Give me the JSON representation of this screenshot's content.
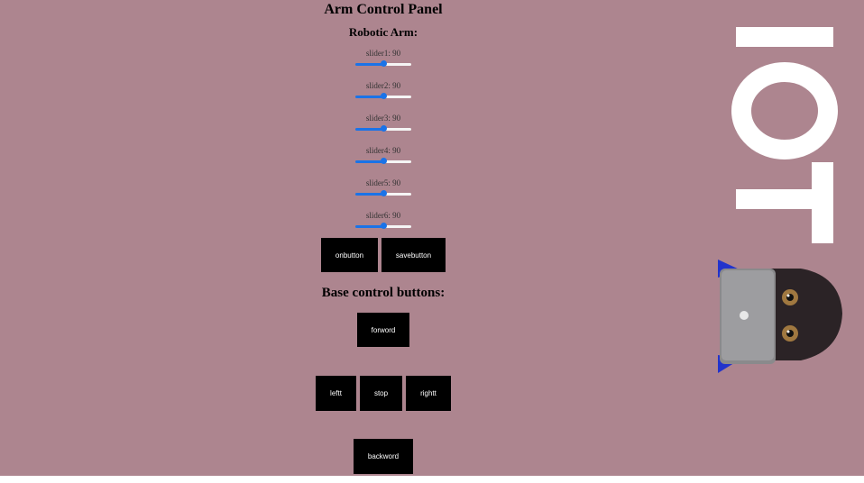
{
  "panel": {
    "title": "Arm Control Panel",
    "subtitle": "Robotic Arm:"
  },
  "sliders": [
    {
      "label": "slider1: 90",
      "value": 90,
      "max": 180
    },
    {
      "label": "slider2: 90",
      "value": 90,
      "max": 180
    },
    {
      "label": "slider3: 90",
      "value": 90,
      "max": 180
    },
    {
      "label": "slider4: 90",
      "value": 90,
      "max": 180
    },
    {
      "label": "slider5: 90",
      "value": 90,
      "max": 180
    },
    {
      "label": "slider6: 90",
      "value": 90,
      "max": 180
    }
  ],
  "arm_buttons": {
    "on_label": "onbutton",
    "save_label": "savebutton"
  },
  "base": {
    "heading": "Base control buttons:",
    "forward_label": "forword",
    "left_label": "leftt",
    "stop_label": "stop",
    "right_label": "rightt",
    "backward_label": "backword"
  },
  "branding": {
    "logo_text": "IOT"
  },
  "colors": {
    "background": "#ad858f",
    "accent": "#1a73e8",
    "button_bg": "#000000"
  }
}
